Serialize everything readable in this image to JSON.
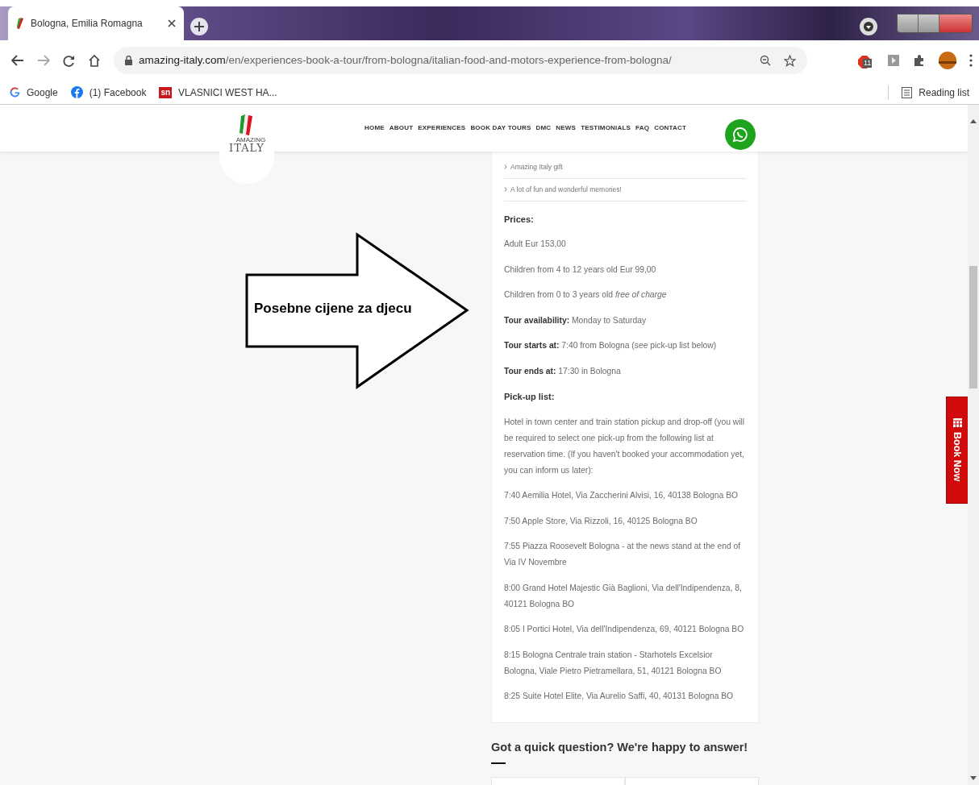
{
  "browser": {
    "tab": {
      "title": "Bologna, Emilia Romagna"
    },
    "url": {
      "host": "amazing-italy.com",
      "path": "/en/experiences-book-a-tour/from-bologna/italian-food-and-motors-experience-from-bologna/"
    },
    "extension_badge": "11",
    "bookmarks": [
      {
        "label": "Google",
        "kind": "google"
      },
      {
        "label": "(1) Facebook",
        "kind": "facebook"
      },
      {
        "label": "VLASNICI WEST HA...",
        "kind": "sn",
        "icon_text": "sn"
      }
    ],
    "reading_list": "Reading list"
  },
  "site": {
    "logo": {
      "line_1": "AMAZING",
      "line_2": "ITALY"
    },
    "nav": [
      "HOME",
      "ABOUT",
      "EXPERIENCES",
      "BOOK DAY TOURS",
      "DMC",
      "NEWS",
      "TESTIMONIALS",
      "FAQ",
      "CONTACT"
    ],
    "included": [
      "Amazing Italy gift",
      "A lot of fun and wonderful memories!"
    ],
    "details": [
      {
        "kind": "heading",
        "text": "Prices:"
      },
      {
        "kind": "text",
        "text": "Adult Eur 153,00"
      },
      {
        "kind": "text",
        "text": "Children from 4 to 12 years old Eur 99,00"
      },
      {
        "kind": "text",
        "text": "Children from 0 to 3 years old *free of charge*"
      },
      {
        "kind": "text",
        "text": "**Tour availability:** Monday to Saturday"
      },
      {
        "kind": "text",
        "text": "**Tour starts at:** 7:40 from Bologna (see pick-up list below)"
      },
      {
        "kind": "text",
        "text": "**Tour ends at:** 17:30 in Bologna"
      },
      {
        "kind": "heading",
        "text": "Pick-up list:"
      },
      {
        "kind": "text",
        "text": "Hotel in town center and train station pickup and drop-off (you will be required to select one pick-up from the following list at reservation time. (If you haven't booked your accommodation yet, you can inform us later):"
      },
      {
        "kind": "text",
        "text": "7:40 Aemilia Hotel, Via Zaccherini Alvisi, 16, 40138 Bologna BO"
      },
      {
        "kind": "text",
        "text": "7:50 Apple Store, Via Rizzoli, 16, 40125 Bologna BO"
      },
      {
        "kind": "text",
        "text": "7:55 Piazza Roosevelt Bologna - at the news stand at the end of Via IV Novembre"
      },
      {
        "kind": "text",
        "text": "8:00 Grand Hotel Majestic Già Baglioni, Via dell'Indipendenza, 8, 40121 Bologna BO"
      },
      {
        "kind": "text",
        "text": "8:05 I Portici Hotel, Via dell'Indipendenza, 69, 40121 Bologna BO"
      },
      {
        "kind": "text",
        "text": "8:15 Bologna Centrale train station - Starhotels Excelsior Bologna, Viale Pietro Pietramellara, 51, 40121 Bologna BO"
      },
      {
        "kind": "text",
        "text": "8:25 Suite Hotel Elite, Via Aurelio Saffi, 40, 40131 Bologna BO"
      }
    ],
    "contact_heading": "Got a quick question? We're happy to answer!",
    "book_now": "Book Now"
  },
  "annotation": {
    "text": "Posebne cijene za djecu"
  }
}
